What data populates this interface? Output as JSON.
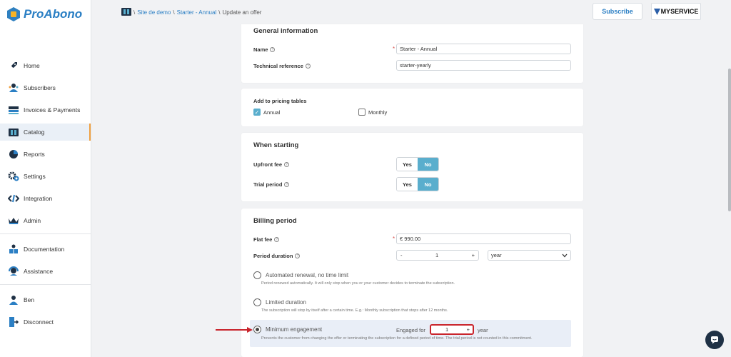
{
  "app": {
    "brand": "ProAbono"
  },
  "sidebar": {
    "items": [
      {
        "label": "Home",
        "icon": "rocket-icon"
      },
      {
        "label": "Subscribers",
        "icon": "users-icon"
      },
      {
        "label": "Invoices & Payments",
        "icon": "invoices-icon"
      },
      {
        "label": "Catalog",
        "icon": "catalog-icon"
      },
      {
        "label": "Reports",
        "icon": "pie-chart-icon"
      },
      {
        "label": "Settings",
        "icon": "gear-icon"
      },
      {
        "label": "Integration",
        "icon": "code-icon"
      },
      {
        "label": "Admin",
        "icon": "crown-icon"
      },
      {
        "label": "Documentation",
        "icon": "book-icon"
      },
      {
        "label": "Assistance",
        "icon": "headset-icon"
      },
      {
        "label": "Ben",
        "icon": "user-icon"
      },
      {
        "label": "Disconnect",
        "icon": "logout-icon"
      }
    ],
    "active": "Catalog"
  },
  "breadcrumb": {
    "root": "Site de demo",
    "offer": "Starter - Annual",
    "current": "Update an offer",
    "sep": "\\"
  },
  "header": {
    "subscribe_label": "Subscribe",
    "myservice_label": "MYSERVICE"
  },
  "general": {
    "title": "General information",
    "name_label": "Name",
    "name_value": "Starter - Annual",
    "techref_label": "Technical reference",
    "techref_value": "starter-yearly",
    "required_mark": "*"
  },
  "pricing": {
    "title": "Add to pricing tables",
    "annual_label": "Annual",
    "annual_checked": true,
    "monthly_label": "Monthly",
    "monthly_checked": false
  },
  "starting": {
    "title": "When starting",
    "upfront_label": "Upfront fee",
    "trial_label": "Trial period",
    "yes_label": "Yes",
    "no_label": "No",
    "upfront_selected": "No",
    "trial_selected": "No"
  },
  "billing": {
    "title": "Billing period",
    "flatfee_label": "Flat fee",
    "flatfee_value": "€ 990.00",
    "duration_label": "Period duration",
    "duration_minus": "-",
    "duration_value": "1",
    "duration_plus": "+",
    "duration_unit": "year",
    "opt_auto_label": "Automated renewal, no time limit",
    "opt_auto_desc": "Period renewed automatically. It will only stop when you or your customer decides to terminate the subscription.",
    "opt_limited_label": "Limited duration",
    "opt_limited_desc": "The subscription will stop by itself after a certain time. E.g.: Monthly subscription that stops after 12 months.",
    "opt_min_label": "Minimum engagement",
    "opt_min_desc": "Prevents the customer from changing the offer or terminating the subscription for a defined period of time. The trial period is not counted in this commitment.",
    "engaged_for_label": "Engaged for",
    "engaged_value": "1",
    "engaged_plus": "+",
    "engaged_unit": "year",
    "selected_option": "Minimum engagement"
  },
  "colors": {
    "accent": "#5aaecd",
    "brand": "#2b7fc4",
    "highlight": "#c9252c",
    "active_nav_border": "#f0a040"
  }
}
